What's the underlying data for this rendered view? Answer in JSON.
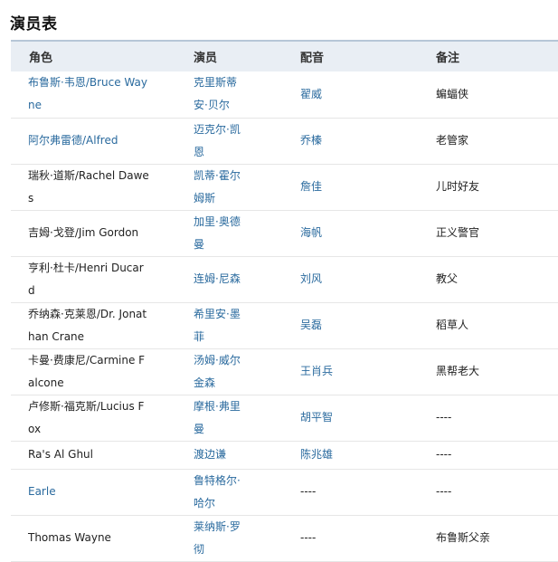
{
  "title": "演员表",
  "table": {
    "headers": [
      "角色",
      "演员",
      "配音",
      "备注"
    ],
    "rows": [
      {
        "role": "布鲁斯·韦恩/Bruce Wayne",
        "role_link": true,
        "actor": "克里斯蒂安·贝尔",
        "dub": "翟威",
        "dub_link": true,
        "note": "蝙蝠侠"
      },
      {
        "role": "阿尔弗雷德/Alfred",
        "role_link": true,
        "actor": "迈克尔·凯恩",
        "dub": "乔榛",
        "dub_link": true,
        "note": "老管家"
      },
      {
        "role": "瑞秋·道斯/Rachel Dawes",
        "role_link": false,
        "actor": "凯蒂·霍尔姆斯",
        "dub": "詹佳",
        "dub_link": true,
        "note": "儿时好友"
      },
      {
        "role": "吉姆·戈登/Jim Gordon",
        "role_link": false,
        "actor": "加里·奥德曼",
        "dub": "海帆",
        "dub_link": true,
        "note": "正义警官"
      },
      {
        "role": "亨利·杜卡/Henri Ducard",
        "role_link": false,
        "actor": "连姆·尼森",
        "dub": "刘风",
        "dub_link": true,
        "note": "教父"
      },
      {
        "role": "乔纳森·克莱恩/Dr. Jonathan Crane",
        "role_link": false,
        "actor": "希里安·墨菲",
        "dub": "吴磊",
        "dub_link": true,
        "note": "稻草人"
      },
      {
        "role": "卡曼·费康尼/Carmine Falcone",
        "role_link": false,
        "actor": "汤姆·威尔金森",
        "dub": "王肖兵",
        "dub_link": true,
        "note": "黑帮老大"
      },
      {
        "role": "卢修斯·福克斯/Lucius Fox",
        "role_link": false,
        "actor": "摩根·弗里曼",
        "dub": "胡平智",
        "dub_link": true,
        "note": "----"
      },
      {
        "role": "Ra's Al Ghul",
        "role_link": false,
        "actor": "渡边谦",
        "dub": "陈兆雄",
        "dub_link": true,
        "note": "----"
      },
      {
        "role": "Earle",
        "role_link": true,
        "actor": "鲁特格尔·哈尔",
        "dub": "----",
        "dub_link": false,
        "note": "----"
      },
      {
        "role": "Thomas Wayne",
        "role_link": false,
        "actor": "莱纳斯·罗彻",
        "dub": "----",
        "dub_link": false,
        "note": "布鲁斯父亲"
      }
    ]
  },
  "colors": {
    "link": "#2a6a9e",
    "header_bg": "#e9eef4",
    "header_border": "#b7c6d7"
  }
}
